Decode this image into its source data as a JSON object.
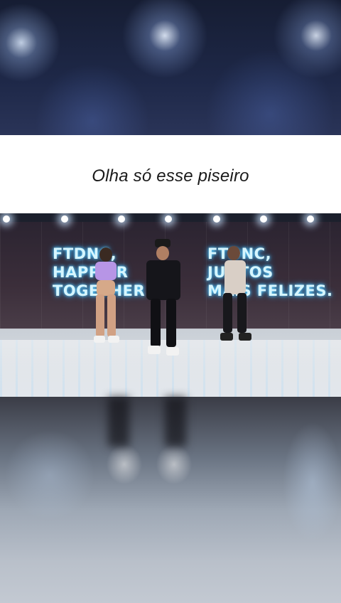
{
  "caption": {
    "text": "Olha só esse piseiro"
  },
  "video": {
    "neon_left": [
      "FTDNC,",
      "HAPPIER",
      "TOGETHER"
    ],
    "neon_right": [
      "FTDNC,",
      "JUNTOS",
      "MAIS FELIZES."
    ]
  }
}
